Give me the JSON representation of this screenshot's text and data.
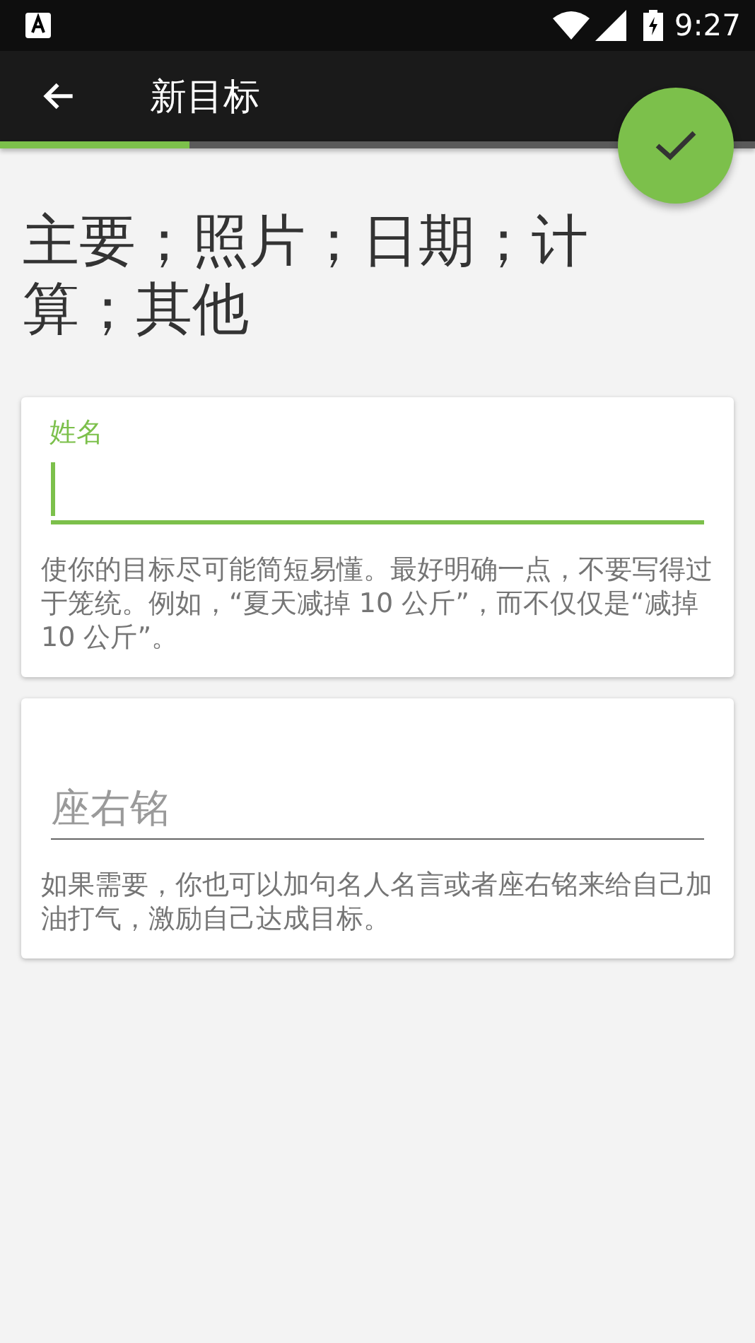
{
  "status_bar": {
    "time": "9:27"
  },
  "toolbar": {
    "title": "新目标",
    "progress": {
      "level": 0.25
    }
  },
  "heading": "主要；照片；日期；计算；其他",
  "fields": [
    {
      "kind": "labeled",
      "label": "姓名",
      "focused": true,
      "help": "使你的目标尽可能简短易懂。最好明确一点，不要写得过于笼统。例如，“夏天减掉 10 公斤”，而不仅仅是“减掉 10 公斤”。"
    },
    {
      "kind": "placeholder",
      "placeholder": "座右铭",
      "focused": false,
      "help": "如果需要，你也可以加句名人名言或者座右铭来给自己加油打气，激励自己达成目标。"
    }
  ]
}
